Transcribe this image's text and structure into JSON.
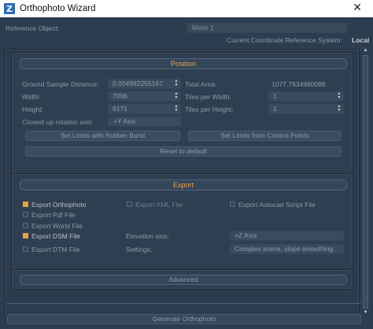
{
  "window": {
    "title": "Orthophoto Wizard",
    "icon_letter": "Z",
    "close_glyph": "✕"
  },
  "reference": {
    "label": "Reference Object:",
    "value": "Mesh 1"
  },
  "crs": {
    "label": "Current Coordinate Reference System:",
    "value": "Local"
  },
  "position": {
    "header": "Position",
    "gsd_label": "Ground Sample Distance:",
    "gsd_value": "0.004992255167",
    "total_area_label": "Total Area:",
    "total_area_value": "1077.7934980088",
    "width_label": "Width:",
    "width_value": "7006",
    "tiles_w_label": "Tiles per Width:",
    "tiles_w_value": "1",
    "height_label": "Height:",
    "height_value": "6171",
    "tiles_h_label": "Tiles per Height:",
    "tiles_h_value": "1",
    "rotation_label": "Closest up rotation axis:",
    "rotation_value": "+Y Axis",
    "rubber_band_label": "Set Limits with Rubber Band",
    "control_points_label": "Set Limits from Control Points",
    "reset_label": "Reset to default"
  },
  "export": {
    "header": "Export",
    "orthophoto_label": "Export Orthophoto",
    "orthophoto_checked": true,
    "kml_label": "Export KML File",
    "kml_checked": false,
    "autocad_label": "Export Autocad Script File",
    "autocad_checked": false,
    "pdf_label": "Export Pdf File",
    "pdf_checked": false,
    "world_label": "Export World File",
    "world_checked": false,
    "dsm_label": "Export DSM File",
    "dsm_checked": true,
    "dtm_label": "Export DTM File",
    "dtm_checked": false,
    "elevation_label": "Elevation axis:",
    "elevation_value": "+Z Axis",
    "settings_label": "Settings:",
    "settings_value": "Complex scene, slope smoothing"
  },
  "advanced": {
    "label": "Advanced"
  },
  "generate": {
    "label": "Generate Orthophoto"
  },
  "colors": {
    "accent": "#e9a13b",
    "background": "#2d3d50",
    "text": "#8d9aa8"
  }
}
